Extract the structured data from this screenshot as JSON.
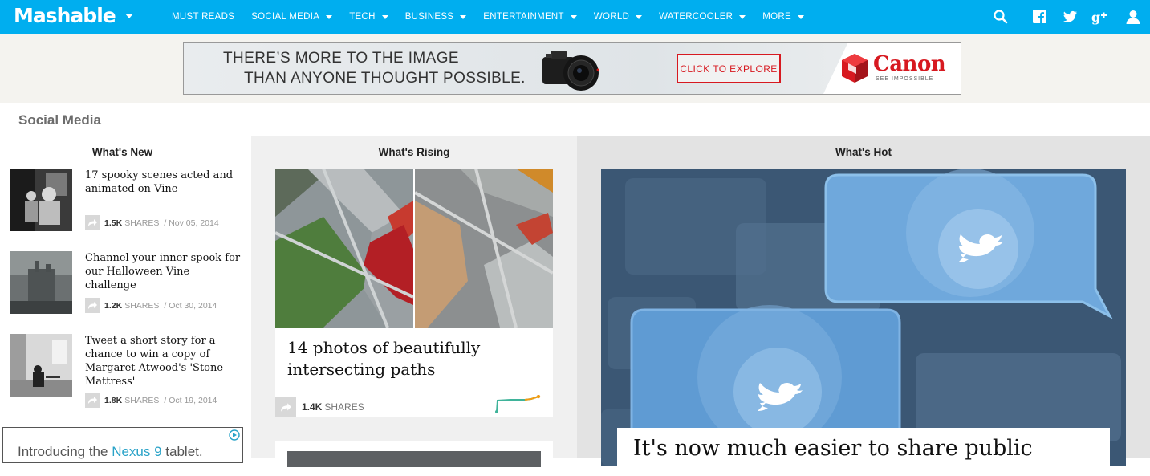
{
  "header": {
    "logo": "Mashable",
    "nav": [
      {
        "label": "MUST READS",
        "dropdown": false
      },
      {
        "label": "SOCIAL MEDIA",
        "dropdown": true
      },
      {
        "label": "TECH",
        "dropdown": true
      },
      {
        "label": "BUSINESS",
        "dropdown": true
      },
      {
        "label": "ENTERTAINMENT",
        "dropdown": true
      },
      {
        "label": "WORLD",
        "dropdown": true
      },
      {
        "label": "WATERCOOLER",
        "dropdown": true
      },
      {
        "label": "MORE",
        "dropdown": true
      }
    ],
    "icons": [
      "search-icon",
      "facebook-icon",
      "twitter-icon",
      "google-plus-icon",
      "user-icon"
    ],
    "bar_color": "#00aeef"
  },
  "ad_banner": {
    "line1": "THERE’S MORE TO THE IMAGE",
    "line2": "THAN ANYONE THOUGHT POSSIBLE.",
    "cta": "CLICK TO EXPLORE",
    "brand": "Canon",
    "brand_tagline": "SEE IMPOSSIBLE",
    "brand_color": "#d71920"
  },
  "section": {
    "title": "Social Media"
  },
  "whats_new": {
    "heading": "What's New",
    "stories": [
      {
        "title": "17 spooky scenes acted and animated on Vine",
        "shares": "1.5K",
        "shares_label": "SHARES",
        "date": "/ Nov 05, 2014"
      },
      {
        "title": "Channel your inner spook for our Halloween Vine challenge",
        "shares": "1.2K",
        "shares_label": "SHARES",
        "date": "/ Oct 30, 2014"
      },
      {
        "title": "Tweet a short story for a chance to win a copy of Margaret Atwood's 'Stone Mattress'",
        "shares": "1.8K",
        "shares_label": "SHARES",
        "date": "/ Oct 19, 2014"
      }
    ],
    "ad": {
      "prefix": "Introducing the ",
      "highlight": "Nexus 9",
      "suffix": " tablet."
    }
  },
  "whats_rising": {
    "heading": "What's Rising",
    "card": {
      "title": "14 photos of beautifully intersecting paths",
      "shares": "1.4K",
      "shares_label": "SHARES"
    }
  },
  "whats_hot": {
    "heading": "What's Hot",
    "card": {
      "title": "It's now much easier to share public"
    }
  }
}
